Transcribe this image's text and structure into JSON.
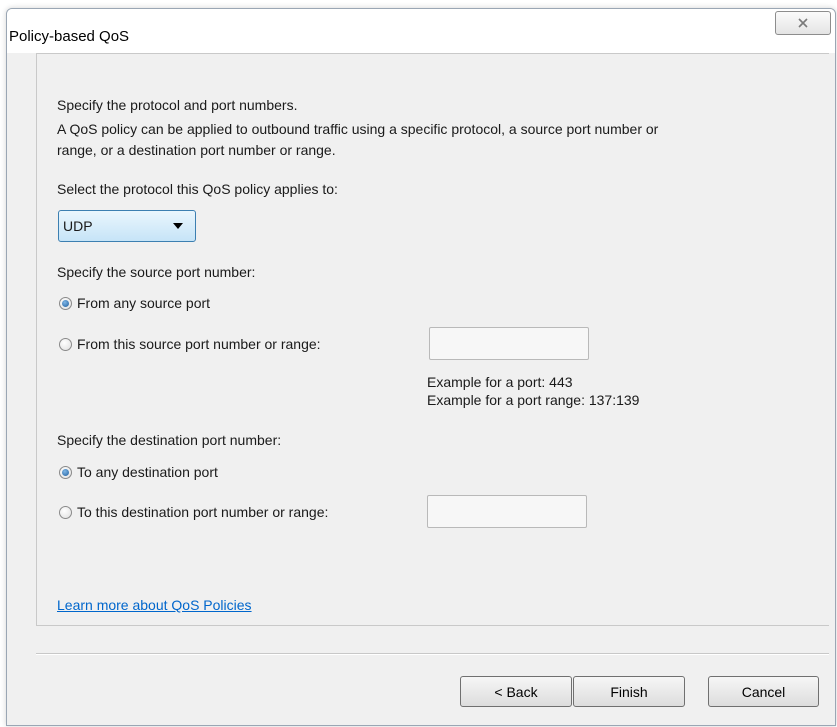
{
  "window": {
    "title": "Policy-based QoS",
    "close_glyph": "✕"
  },
  "page": {
    "heading": "Specify the protocol and port numbers.",
    "description_line1": "A QoS policy can be applied to outbound traffic using a specific protocol, a source port number or",
    "description_line2": "range, or a destination port number or range."
  },
  "protocol": {
    "label": "Select the protocol this QoS policy applies to:",
    "selected": "UDP"
  },
  "source": {
    "label": "Specify the source port number:",
    "option_any": "From any source port",
    "option_specific": "From this source port number or range:",
    "selected": "any",
    "value": "",
    "example_port": "Example for a port: 443",
    "example_range": "Example for a port range: 137:139"
  },
  "destination": {
    "label": "Specify the destination port number:",
    "option_any": "To any destination port",
    "option_specific": "To this destination port number or range:",
    "selected": "any",
    "value": ""
  },
  "link": {
    "text": "Learn more about QoS Policies"
  },
  "buttons": {
    "back": "< Back",
    "finish": "Finish",
    "cancel": "Cancel"
  },
  "colors": {
    "link": "#0066cc",
    "dropdown_border": "#3c7fb1"
  }
}
